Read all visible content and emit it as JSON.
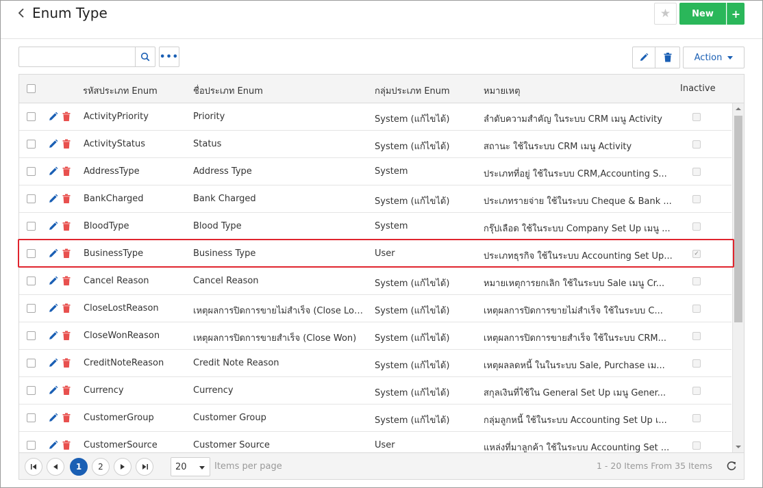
{
  "header": {
    "title": "Enum Type",
    "new_label": "New",
    "new_plus": "+"
  },
  "toolbar": {
    "search_placeholder": "",
    "more_label": "•••",
    "action_label": "Action"
  },
  "columns": {
    "code": "รหัสประเภท Enum",
    "name": "ชื่อประเภท Enum",
    "group": "กลุ่มประเภท Enum",
    "note": "หมายเหตุ",
    "inactive": "Inactive"
  },
  "rows": [
    {
      "code": "ActivityPriority",
      "name": "Priority",
      "group": "System (แก้ไขได้)",
      "note": "ลำดับความสำคัญ ในระบบ CRM เมนู Activity",
      "inactive": false
    },
    {
      "code": "ActivityStatus",
      "name": "Status",
      "group": "System (แก้ไขได้)",
      "note": "สถานะ ใช้ในระบบ CRM เมนู Activity",
      "inactive": false
    },
    {
      "code": "AddressType",
      "name": "Address Type",
      "group": "System",
      "note": "ประเภทที่อยู่ ใช้ในระบบ CRM,Accounting S...",
      "inactive": false
    },
    {
      "code": "BankCharged",
      "name": "Bank Charged",
      "group": "System (แก้ไขได้)",
      "note": "ประเภทรายจ่าย ใช้ในระบบ Cheque & Bank ...",
      "inactive": false
    },
    {
      "code": "BloodType",
      "name": "Blood Type",
      "group": "System",
      "note": "กรุ๊ปเลือด ใช้ในระบบ Company Set Up เมนู ...",
      "inactive": false
    },
    {
      "code": "BusinessType",
      "name": "Business Type",
      "group": "User",
      "note": "ประเภทธุรกิจ ใช้ในระบบ Accounting Set Up...",
      "inactive": true
    },
    {
      "code": "Cancel Reason",
      "name": "Cancel Reason",
      "group": "System (แก้ไขได้)",
      "note": "หมายเหตุการยกเลิก ใช้ในระบบ Sale เมนู Cr...",
      "inactive": false
    },
    {
      "code": "CloseLostReason",
      "name": "เหตุผลการปิดการขายไม่สำเร็จ (Close Lost)",
      "group": "System (แก้ไขได้)",
      "note": "เหตุผลการปิดการขายไม่สำเร็จ ใช้ในระบบ C...",
      "inactive": false
    },
    {
      "code": "CloseWonReason",
      "name": "เหตุผลการปิดการขายสำเร็จ (Close Won)",
      "group": "System (แก้ไขได้)",
      "note": "เหตุผลการปิดการขายสำเร็จ ใช้ในระบบ CRM...",
      "inactive": false
    },
    {
      "code": "CreditNoteReason",
      "name": "Credit Note Reason",
      "group": "System (แก้ไขได้)",
      "note": "เหตุผลลดหนี้ ในในระบบ Sale, Purchase เม...",
      "inactive": false
    },
    {
      "code": "Currency",
      "name": "Currency",
      "group": "System (แก้ไขได้)",
      "note": "สกุลเงินที่ใช้ใน General Set Up เมนู Gener...",
      "inactive": false
    },
    {
      "code": "CustomerGroup",
      "name": "Customer Group",
      "group": "System (แก้ไขได้)",
      "note": "กลุ่มลูกหนี้ ใช้ในระบบ Accounting Set Up เ...",
      "inactive": false
    },
    {
      "code": "CustomerSource",
      "name": "Customer Source",
      "group": "User",
      "note": "แหล่งที่มาลูกค้า ใช้ในระบบ Accounting Set ...",
      "inactive": false
    }
  ],
  "pager": {
    "pages": [
      "1",
      "2"
    ],
    "current_page": "1",
    "page_size": "20",
    "items_per_page_label": "Items per page",
    "range_text": "1 - 20 Items From 35 Items"
  },
  "icons": {
    "back": "chevron-left-icon",
    "star": "star-icon",
    "search": "search-icon",
    "edit": "pencil-icon",
    "delete": "trash-icon",
    "refresh": "refresh-icon"
  },
  "colors": {
    "primary": "#1a5fb4",
    "success": "#2ab75a",
    "danger": "#e0242d",
    "trash": "#e8504e"
  }
}
